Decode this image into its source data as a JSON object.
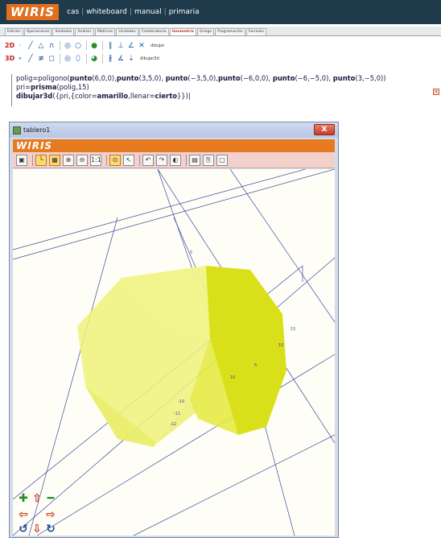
{
  "app": {
    "logo": "WIRIS",
    "links": [
      "cas",
      "whiteboard",
      "manual",
      "primaria"
    ]
  },
  "tabs": [
    {
      "label": "Edición",
      "active": false
    },
    {
      "label": "Operaciones",
      "active": false
    },
    {
      "label": "Símbolos",
      "active": false
    },
    {
      "label": "Análisis",
      "active": false
    },
    {
      "label": "Matrices",
      "active": false
    },
    {
      "label": "Unidades",
      "active": false
    },
    {
      "label": "Combinatoria",
      "active": false
    },
    {
      "label": "Geometría",
      "active": true
    },
    {
      "label": "Griego",
      "active": false
    },
    {
      "label": "Programación",
      "active": false
    },
    {
      "label": "Formato",
      "active": false
    }
  ],
  "toolbar": {
    "row1_badge": "2D",
    "row2_badge": "3D",
    "row1_text": "dibujar",
    "row2_text": "dibujar3d"
  },
  "editor": {
    "line1_parts": [
      "polig=poligono(",
      "punto",
      "(6,0,0),",
      "punto",
      "(3,5,0), ",
      "punto",
      "(−3,5,0),",
      "punto",
      "(−6,0,0), ",
      "punto",
      "(−6,−5,0), ",
      "punto",
      "(3,−5,0))"
    ],
    "line2_parts": [
      "pri=",
      "prisma",
      "(polig,15)"
    ],
    "line3_parts": [
      "dibujar3d",
      "({pri,{color=",
      "amarillo",
      ",llenar=",
      "cierto",
      "}})"
    ]
  },
  "window": {
    "title": "tablero1",
    "close_label": "X",
    "logo": "WIRIS"
  },
  "board": {
    "prism_color_front": "#d9e01a",
    "prism_color_side": "#eef27a",
    "axis_color": "#3a48a0",
    "tick_labels": [
      "-10",
      "-11",
      "-12",
      "5",
      "10",
      "15",
      "5",
      "10"
    ]
  },
  "navpad_icons": [
    "move-up",
    "rotate-up",
    "zoom-out",
    "move-left",
    "move-right",
    "rotate-left",
    "move-down",
    "rotate-right"
  ]
}
